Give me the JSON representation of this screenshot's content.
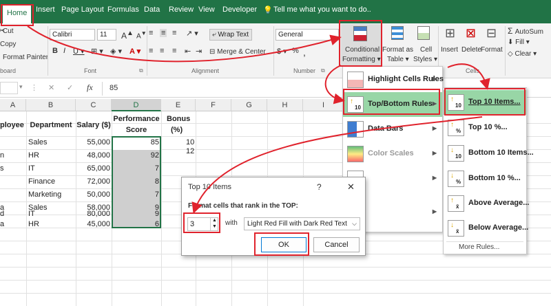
{
  "tabs": {
    "home": "Home",
    "insert": "Insert",
    "page_layout": "Page Layout",
    "formulas": "Formulas",
    "data": "Data",
    "review": "Review",
    "view": "View",
    "developer": "Developer",
    "tell_me": "Tell me what you want to do.."
  },
  "ribbon": {
    "cut": "Cut",
    "copy": "Copy",
    "format_painter": "Format Painter",
    "clipboard": "board",
    "font_name": "Calibri",
    "font_size": "11",
    "font_group": "Font",
    "wrap_text": "Wrap Text",
    "merge_center": "Merge & Center",
    "alignment_group": "Alignment",
    "number_format": "General",
    "number_group": "Number",
    "conditional_formatting_1": "Conditional",
    "conditional_formatting_2": "Formatting ▾",
    "format_as_table_1": "Format as",
    "format_as_table_2": "Table ▾",
    "cell_styles_1": "Cell",
    "cell_styles_2": "Styles ▾",
    "insert": "Insert",
    "delete": "Delete",
    "format": "Format",
    "cells_group": "Cells",
    "autosum": "AutoSum",
    "fill": "Fill ▾",
    "clear": "Clear ▾"
  },
  "formula_bar": {
    "fx": "fx",
    "value": "85"
  },
  "columns": [
    "A",
    "B",
    "C",
    "D",
    "E",
    "F",
    "G",
    "H",
    "I"
  ],
  "headers": {
    "employee": "ployee",
    "department": "Department",
    "salary": "Salary ($)",
    "performance_1": "Performance",
    "performance_2": "Score",
    "bonus_1": "Bonus",
    "bonus_2": "(%)"
  },
  "rows": [
    {
      "a": "",
      "dept": "Sales",
      "salary": "55,000",
      "score": "85",
      "bonus": "10"
    },
    {
      "a": "n",
      "dept": "HR",
      "salary": "48,000",
      "score": "92",
      "bonus": "12"
    },
    {
      "a": "s",
      "dept": "IT",
      "salary": "65,000",
      "score": "7",
      "bonus": ""
    },
    {
      "a": "",
      "dept": "Finance",
      "salary": "72,000",
      "score": "8",
      "bonus": ""
    },
    {
      "a": "",
      "dept": "Marketing",
      "salary": "50,000",
      "score": "7",
      "bonus": ""
    },
    {
      "a": "a",
      "dept": "Sales",
      "salary": "58,000",
      "score": "9",
      "bonus": ""
    },
    {
      "a": "d",
      "dept": "IT",
      "salary": "80,000",
      "score": "9",
      "bonus": ""
    },
    {
      "a": "a",
      "dept": "HR",
      "salary": "45,000",
      "score": "6",
      "bonus": ""
    }
  ],
  "cf_menu": [
    {
      "label": "Highlight Cells Rules"
    },
    {
      "label": "Top/Bottom Rules"
    },
    {
      "label": "Data Bars"
    },
    {
      "label": "Color Scales"
    },
    {
      "label": ""
    },
    {
      "label": ""
    }
  ],
  "submenu": [
    {
      "label": "Top 10 Items..."
    },
    {
      "label": "Top 10 %..."
    },
    {
      "label": "Bottom 10 Items..."
    },
    {
      "label": "Bottom 10 %..."
    },
    {
      "label": "Above Average..."
    },
    {
      "label": "Below Average..."
    }
  ],
  "submenu_more": "More Rules...",
  "dialog": {
    "title": "Top 10 Items",
    "help": "?",
    "close": "✕",
    "prompt": "Format cells that rank in the TOP:",
    "count": "3",
    "with": "with",
    "format_option": "Light Red Fill with Dark Red Text",
    "ok": "OK",
    "cancel": "Cancel"
  },
  "colors": {
    "excel_green": "#217346",
    "highlight_green": "#98d6a6",
    "annotation_red": "#e0222c"
  }
}
